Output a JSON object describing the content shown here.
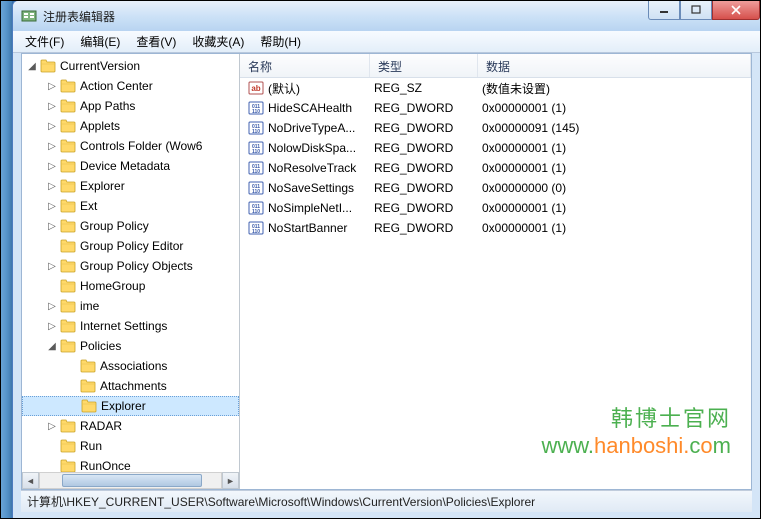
{
  "window": {
    "title": "注册表编辑器"
  },
  "menu": {
    "file": "文件(F)",
    "edit": "编辑(E)",
    "view": "查看(V)",
    "favorites": "收藏夹(A)",
    "help": "帮助(H)"
  },
  "tree": {
    "root": "CurrentVersion",
    "items": [
      {
        "label": "Action Center",
        "children": true
      },
      {
        "label": "App Paths",
        "children": true
      },
      {
        "label": "Applets",
        "children": true
      },
      {
        "label": "Controls Folder (Wow6",
        "children": true
      },
      {
        "label": "Device Metadata",
        "children": true
      },
      {
        "label": "Explorer",
        "children": true
      },
      {
        "label": "Ext",
        "children": true
      },
      {
        "label": "Group Policy",
        "children": true
      },
      {
        "label": "Group Policy Editor",
        "children": false
      },
      {
        "label": "Group Policy Objects",
        "children": true
      },
      {
        "label": "HomeGroup",
        "children": false
      },
      {
        "label": "ime",
        "children": true
      },
      {
        "label": "Internet Settings",
        "children": true
      }
    ],
    "policies": {
      "label": "Policies",
      "children": [
        {
          "label": "Associations"
        },
        {
          "label": "Attachments"
        },
        {
          "label": "Explorer",
          "selected": true
        }
      ]
    },
    "after": [
      {
        "label": "RADAR",
        "children": true
      },
      {
        "label": "Run",
        "children": false
      },
      {
        "label": "RunOnce",
        "children": false
      }
    ]
  },
  "list": {
    "headers": {
      "name": "名称",
      "type": "类型",
      "data": "数据"
    },
    "rows": [
      {
        "icon": "sz",
        "name": "(默认)",
        "type": "REG_SZ",
        "data": "(数值未设置)"
      },
      {
        "icon": "dw",
        "name": "HideSCAHealth",
        "type": "REG_DWORD",
        "data": "0x00000001 (1)"
      },
      {
        "icon": "dw",
        "name": "NoDriveTypeA...",
        "type": "REG_DWORD",
        "data": "0x00000091 (145)"
      },
      {
        "icon": "dw",
        "name": "NolowDiskSpa...",
        "type": "REG_DWORD",
        "data": "0x00000001 (1)"
      },
      {
        "icon": "dw",
        "name": "NoResolveTrack",
        "type": "REG_DWORD",
        "data": "0x00000001 (1)"
      },
      {
        "icon": "dw",
        "name": "NoSaveSettings",
        "type": "REG_DWORD",
        "data": "0x00000000 (0)"
      },
      {
        "icon": "dw",
        "name": "NoSimpleNetI...",
        "type": "REG_DWORD",
        "data": "0x00000001 (1)"
      },
      {
        "icon": "dw",
        "name": "NoStartBanner",
        "type": "REG_DWORD",
        "data": "0x00000001 (1)"
      }
    ]
  },
  "statusbar": {
    "path": "计算机\\HKEY_CURRENT_USER\\Software\\Microsoft\\Windows\\CurrentVersion\\Policies\\Explorer"
  },
  "watermark": {
    "line1": "韩博士官网",
    "line2_a": "www.",
    "line2_b": "hanboshi.",
    "line2_c": "c",
    "line2_d": "o",
    "line2_e": "m"
  }
}
